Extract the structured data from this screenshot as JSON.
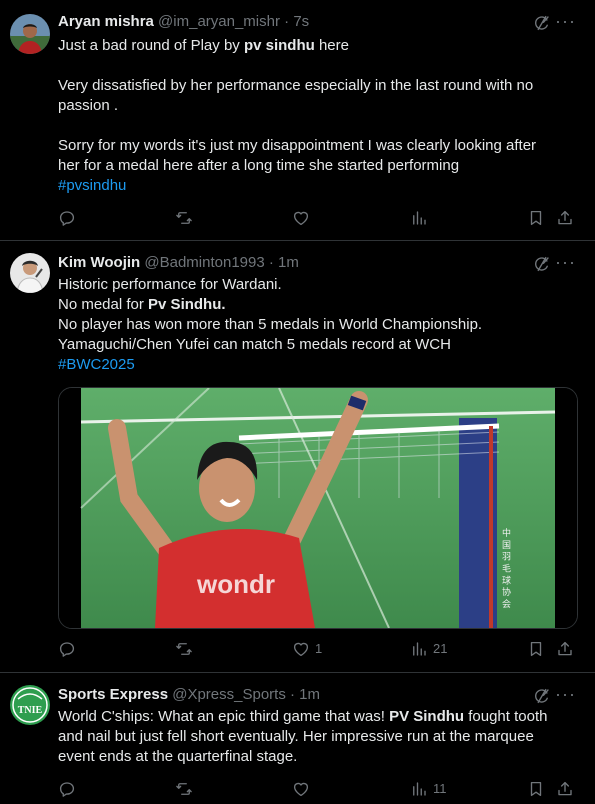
{
  "tweets": [
    {
      "name": "Aryan mishra",
      "handle": "@im_aryan_mishr",
      "separator": "·",
      "time": "7s",
      "lines": {
        "l1_pre": "Just a bad round of Play by ",
        "l1_bold": "pv sindhu",
        "l1_post": " here",
        "l2": "Very dissatisfied by her performance especially in the last round with no",
        "l3": "passion .",
        "l4": "Sorry for my words it's just my disappointment I was clearly looking after",
        "l5": "her for a medal here after a long time she started performing",
        "hashtag": "#pvsindhu"
      },
      "counts": {
        "replies": "",
        "reposts": "",
        "likes": "",
        "views": ""
      }
    },
    {
      "name": "Kim Woojin",
      "handle": "@Badminton1993",
      "separator": "·",
      "time": "1m",
      "lines": {
        "l1": "Historic performance for Wardani.",
        "l2_pre": "No medal for ",
        "l2_bold": "Pv Sindhu.",
        "l3": "No player has won more than 5 medals in World Championship.",
        "l4": "Yamaguchi/Chen Yufei can match 5 medals record at WCH",
        "hashtag": "#BWC2025"
      },
      "media": {
        "shirt_text": "wondr",
        "caption_text": "中 国 羽 毛 球 协 会"
      },
      "counts": {
        "replies": "",
        "reposts": "",
        "likes": "1",
        "views": "21"
      }
    },
    {
      "name": "Sports Express",
      "handle": "@Xpress_Sports",
      "separator": "·",
      "time": "1m",
      "avatar_text": "TNIE",
      "lines": {
        "l1_pre": "World C'ships: What an epic third game that was! ",
        "l1_bold": "PV Sindhu",
        "l1_post": " fought tooth",
        "l2": "and nail but just fell short eventually. Her impressive run at the marquee",
        "l3": "event ends at the quarterfinal stage."
      },
      "counts": {
        "replies": "",
        "reposts": "",
        "likes": "",
        "views": "11"
      }
    }
  ],
  "colors": {
    "background": "#000000",
    "text": "#e7e9ea",
    "muted": "#71767b",
    "link": "#1d9bf0",
    "divider": "#2f3336"
  },
  "icons": [
    "grok-icon",
    "more-icon",
    "reply-icon",
    "repost-icon",
    "like-icon",
    "views-icon",
    "bookmark-icon",
    "share-icon"
  ]
}
